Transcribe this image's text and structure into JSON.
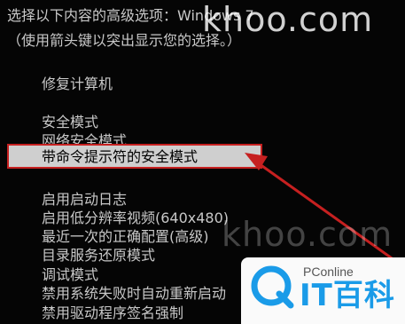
{
  "header": {
    "line1_prefix": "选择以下内容的高级选项：",
    "line1_os": "Windows 7",
    "line2": "（使用箭头键以突出显示您的选择。）"
  },
  "repair_item": "修复计算机",
  "safe_modes": [
    "安全模式",
    "网络安全模式"
  ],
  "selected_item": "带命令提示符的安全模式",
  "other_items": [
    "启用启动日志",
    "启用低分辨率视频(640x480)",
    "最近一次的正确配置(高级)",
    "目录服务还原模式",
    "调试模式",
    "禁用系统失败时自动重新启动",
    "禁用驱动程序签名强制"
  ],
  "watermark": {
    "site": "khoo.com",
    "brand_small": "PConline",
    "brand_large": "IT百科"
  },
  "colors": {
    "background": "#050505",
    "text": "#c8c8c8",
    "highlight": "#cfcfcf",
    "annotation_red": "#c62020",
    "logo_blue": "#1a9be8"
  }
}
